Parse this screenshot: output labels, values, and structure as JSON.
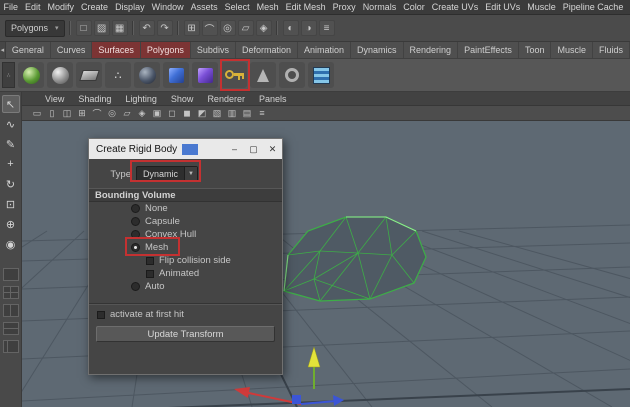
{
  "colors": {
    "annotation_red": "#c43131",
    "viewport_bg": "#5e6973",
    "mesh_wire_green": "#3dae47",
    "titlebar_accent_blue": "#4a79d0",
    "shelf_tab_highlight": "#7c3434"
  },
  "menubar": {
    "items": [
      "File",
      "Edit",
      "Modify",
      "Create",
      "Display",
      "Window",
      "Assets",
      "Select",
      "Mesh",
      "Edit Mesh",
      "Proxy",
      "Normals",
      "Color",
      "Create UVs",
      "Edit UVs",
      "Muscle",
      "Pipeline Cache"
    ]
  },
  "statusline": {
    "mode": "Polygons",
    "dropdown_arrow": "▾",
    "icons": [
      {
        "name": "scene-new-icon",
        "glyph": "□"
      },
      {
        "name": "scene-open-icon",
        "glyph": "▨"
      },
      {
        "name": "scene-save-icon",
        "glyph": "▦"
      },
      {
        "name": "undo-icon",
        "glyph": "↶"
      },
      {
        "name": "redo-icon",
        "glyph": "↷"
      },
      {
        "name": "snap-grid-icon",
        "glyph": "⊞"
      },
      {
        "name": "snap-curve-icon",
        "glyph": "⌒"
      },
      {
        "name": "snap-point-icon",
        "glyph": "◎"
      },
      {
        "name": "snap-plane-icon",
        "glyph": "▱"
      },
      {
        "name": "snap-center-icon",
        "glyph": "◈"
      },
      {
        "name": "render-icon",
        "glyph": "◐"
      },
      {
        "name": "ipr-render-icon",
        "glyph": "◑"
      },
      {
        "name": "render-settings-icon",
        "glyph": "≡"
      }
    ]
  },
  "shelf": {
    "tabs": [
      "General",
      "Curves",
      "Surfaces",
      "Polygons",
      "Subdivs",
      "Deformation",
      "Animation",
      "Dynamics",
      "Rendering",
      "PaintEffects",
      "Toon",
      "Muscle",
      "Fluids"
    ],
    "icons": [
      "paint-sphere-icon",
      "nurbs-sphere-icon",
      "nurbs-plane-icon",
      "particles-icon",
      "shaded-sphere-icon",
      "poly-cube-blue-icon",
      "poly-cube-purple-icon",
      "rigid-body-key-icon",
      "gravity-cone-icon",
      "torus-icon",
      "fluid-container-icon"
    ],
    "particles_glyph": "∴",
    "shelf_menu_glyph": "▾"
  },
  "toolbox": {
    "tools": [
      {
        "name": "select-tool",
        "glyph": "↖"
      },
      {
        "name": "lasso-tool",
        "glyph": "∿"
      },
      {
        "name": "paint-select-tool",
        "glyph": "✎"
      },
      {
        "name": "move-tool",
        "glyph": "+"
      },
      {
        "name": "rotate-tool",
        "glyph": "↻"
      },
      {
        "name": "scale-tool",
        "glyph": "⊡"
      },
      {
        "name": "universal-manipulator-tool",
        "glyph": "⊕"
      },
      {
        "name": "soft-mod-tool",
        "glyph": "◉"
      }
    ]
  },
  "panel": {
    "menus": [
      "View",
      "Shading",
      "Lighting",
      "Show",
      "Renderer",
      "Panels"
    ],
    "icons": [
      {
        "name": "camera-icon",
        "glyph": "▭"
      },
      {
        "name": "film-gate-icon",
        "glyph": "▯"
      },
      {
        "name": "resolution-gate-icon",
        "glyph": "◫"
      },
      {
        "name": "gate-mask-icon",
        "glyph": "⊞"
      },
      {
        "name": "field-chart-icon",
        "glyph": "⌒"
      },
      {
        "name": "safe-action-icon",
        "glyph": "◎"
      },
      {
        "name": "safe-title-icon",
        "glyph": "▱"
      },
      {
        "name": "frame-all-icon",
        "glyph": "◈"
      },
      {
        "name": "wireframe-icon",
        "glyph": "▣"
      },
      {
        "name": "shaded-icon",
        "glyph": "◻"
      },
      {
        "name": "textured-icon",
        "glyph": "◼"
      },
      {
        "name": "lights-icon",
        "glyph": "◩"
      },
      {
        "name": "shadows-icon",
        "glyph": "▧"
      },
      {
        "name": "ao-icon",
        "glyph": "▥"
      },
      {
        "name": "motion-blur-icon",
        "glyph": "▤"
      },
      {
        "name": "isolate-icon",
        "glyph": "≡"
      }
    ]
  },
  "dialog": {
    "title": "Create Rigid Body",
    "minimize": "–",
    "maximize": "▢",
    "close": "✕",
    "type_label": "Type",
    "type_value": "Dynamic",
    "section_label": "Bounding Volume",
    "options": [
      {
        "label": "None",
        "kind": "radio",
        "checked": false
      },
      {
        "label": "Capsule",
        "kind": "radio",
        "checked": false
      },
      {
        "label": "Convex Hull",
        "kind": "radio",
        "checked": false
      },
      {
        "label": "Mesh",
        "kind": "radio",
        "checked": true
      },
      {
        "label": "Flip collision side",
        "kind": "checkbox",
        "checked": false
      },
      {
        "label": "Animated",
        "kind": "checkbox",
        "checked": false
      },
      {
        "label": "Auto",
        "kind": "radio",
        "checked": false
      }
    ],
    "activate_label": "activate at first hit",
    "update_button": "Update Transform"
  }
}
